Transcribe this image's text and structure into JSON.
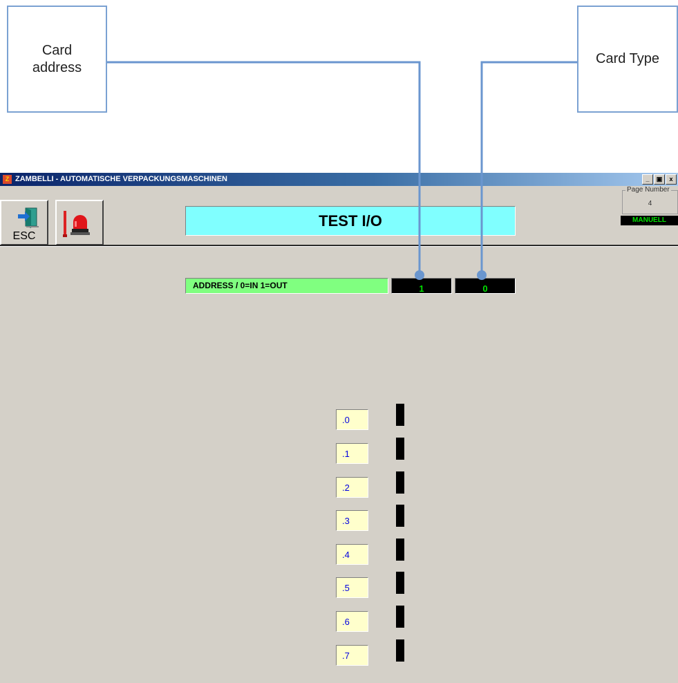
{
  "callouts": {
    "card_address": "Card\naddress",
    "card_type": "Card Type"
  },
  "window": {
    "title": "ZAMBELLI - AUTOMATISCHE VERPACKUNGSMASCHINEN",
    "app_icon_glyph": "Z",
    "controls": {
      "minimize": "_",
      "restore": "▣",
      "close": "x"
    }
  },
  "toolbar": {
    "esc_label": "ESC",
    "esc_icon": "door-exit-icon",
    "alarm_icon": "alarm-beacon-icon"
  },
  "header": {
    "title": "TEST I/O",
    "page_number_label": "Page Number",
    "page_number": "4",
    "mode": "MANUELL"
  },
  "address_row": {
    "label": "ADDRESS / 0=IN 1=OUT",
    "card_address": "1",
    "card_type": "0"
  },
  "bits": [
    ".0",
    ".1",
    ".2",
    ".3",
    ".4",
    ".5",
    ".6",
    ".7"
  ],
  "colors": {
    "title_bg": "#80ffff",
    "address_bg": "#80ff80",
    "value_text": "#00e000",
    "bit_label_bg": "#ffffcc",
    "bit_text": "#0000e0",
    "callout_line": "#6a96cf",
    "window_bg": "#d4d0c8"
  }
}
